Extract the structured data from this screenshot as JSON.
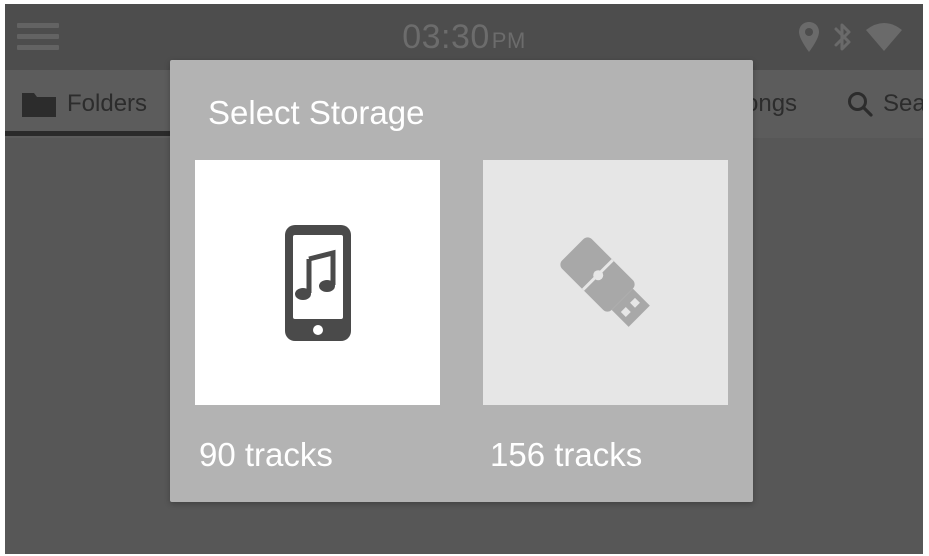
{
  "status_bar": {
    "time": "03:30",
    "ampm": "PM",
    "icons": [
      "menu-icon",
      "location-pin-icon",
      "bluetooth-icon",
      "wifi-icon"
    ]
  },
  "tabs": [
    {
      "label": "Folders",
      "icon": "folder-icon",
      "selected": true
    },
    {
      "label": "ongs",
      "icon": null,
      "selected": false
    },
    {
      "label": "Sea",
      "icon": "search-icon",
      "selected": false
    }
  ],
  "dialog": {
    "title": "Select Storage",
    "options": [
      {
        "icon": "phone-music-icon",
        "label": "90 tracks",
        "selected": true
      },
      {
        "icon": "usb-drive-icon",
        "label": "156 tracks",
        "selected": false
      }
    ]
  },
  "colors": {
    "screen_bg": "#555555",
    "status_bar_bg": "#4d4d4d",
    "tab_bar_bg": "#5c5c5c",
    "dialog_bg": "#b3b3b3",
    "tile_selected_bg": "#ffffff",
    "tile_unselected_bg": "#e6e6e6",
    "icon_dark": "#4a4a4a",
    "icon_light": "#a8a8a8"
  }
}
